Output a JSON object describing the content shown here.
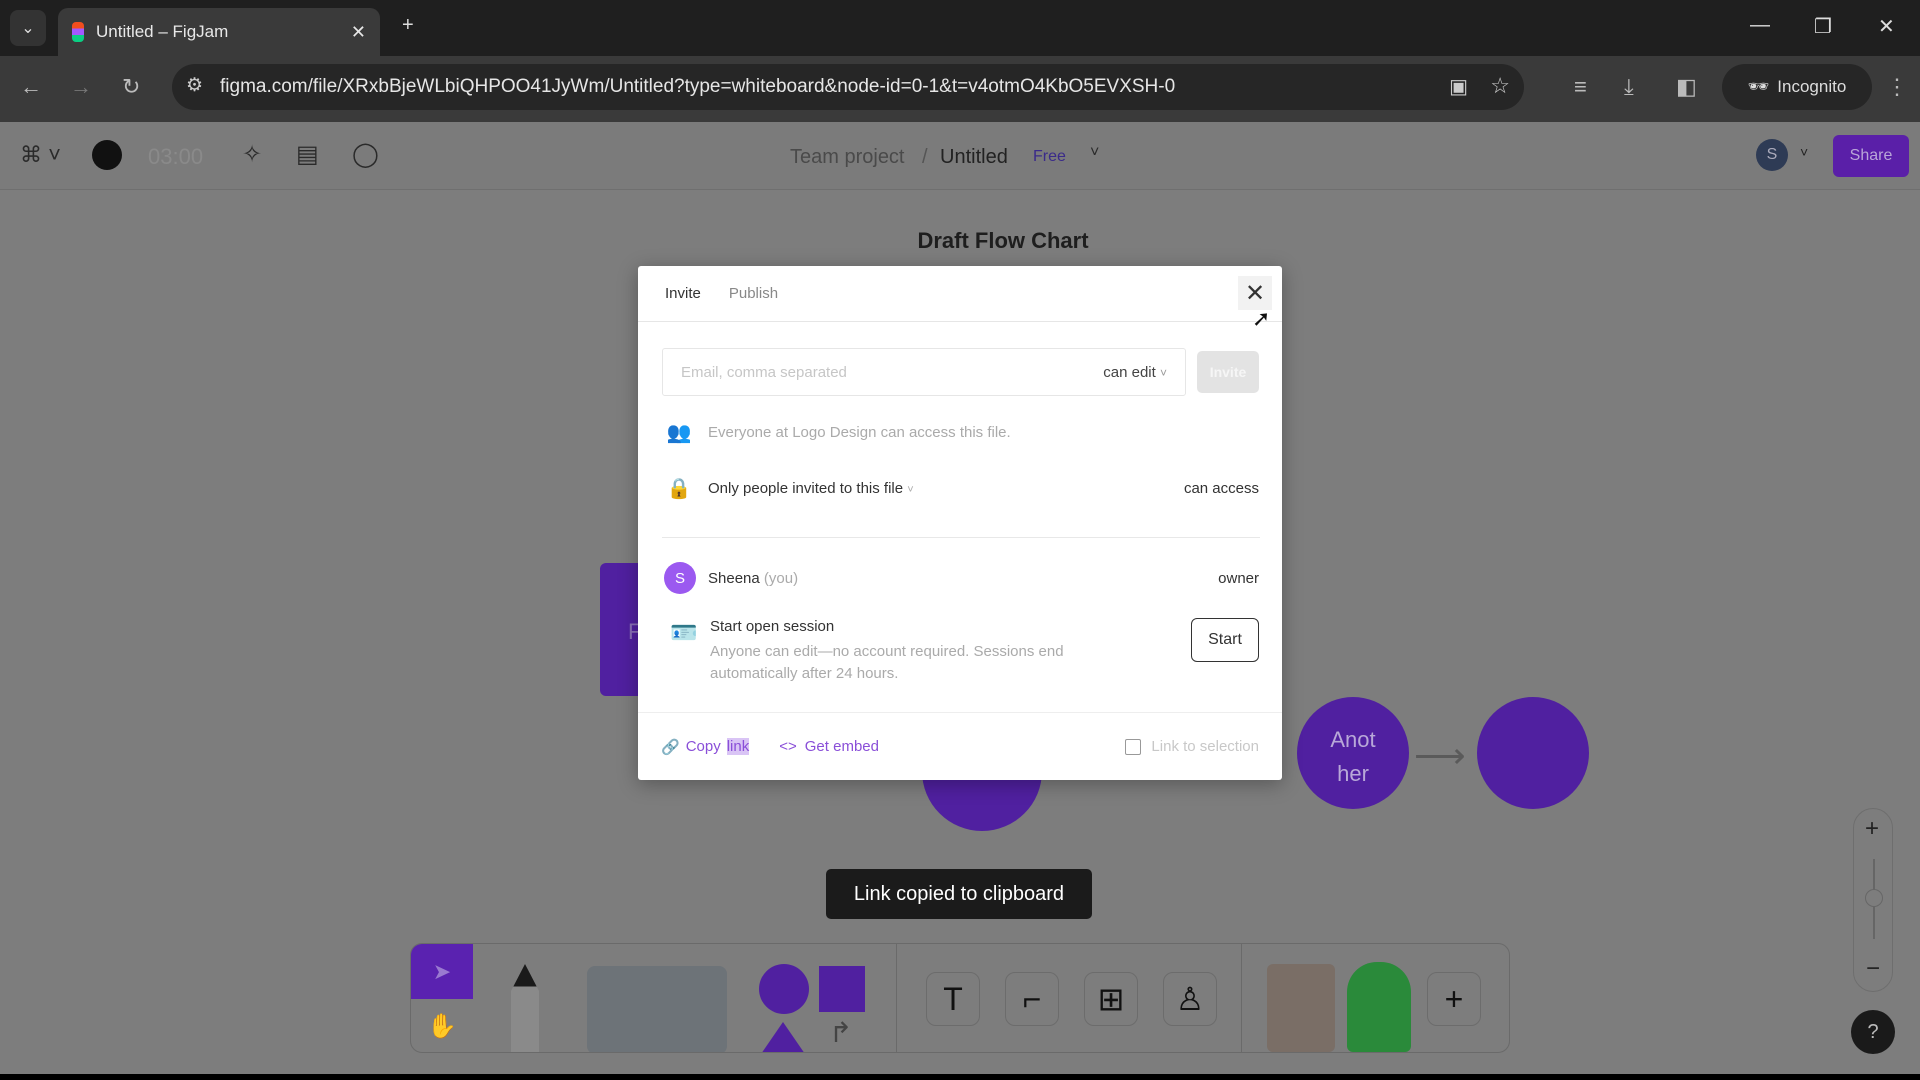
{
  "browser": {
    "tab_title": "Untitled – FigJam",
    "url": "figma.com/file/XRxbBjeWLbiQHPOO41JyWm/Untitled?type=whiteboard&node-id=0-1&t=v4otmO4KbO5EVXSH-0",
    "incognito_label": "Incognito"
  },
  "figma": {
    "timer": "03:00",
    "breadcrumb_project": "Team project",
    "breadcrumb_sep": "/",
    "file_name": "Untitled",
    "plan_badge": "Free",
    "user_initial": "S",
    "share_label": "Share"
  },
  "canvas": {
    "title": "Draft Flow Chart",
    "shape_partial_text": "F",
    "circle_text_1": "Anot",
    "circle_text_2": "her",
    "accent": "#5020a0"
  },
  "dialog": {
    "tabs": [
      "Invite",
      "Publish"
    ],
    "email_placeholder": "Email, comma separated",
    "email_permission": "can edit",
    "invite_label": "Invite",
    "org_access": "Everyone at Logo Design can access this file.",
    "access_scope": "Only people invited to this file",
    "access_level": "can access",
    "member": {
      "initial": "S",
      "name": "Sheena",
      "you": "(you)",
      "role": "owner"
    },
    "session_title": "Start open session",
    "session_desc": "Anyone can edit—no account required. Sessions end automatically after 24 hours.",
    "start_label": "Start",
    "copy_link_1": "Copy",
    "copy_link_2": "link",
    "get_embed": "Get embed",
    "link_to_selection": "Link to selection"
  },
  "toast": "Link copied to clipboard"
}
